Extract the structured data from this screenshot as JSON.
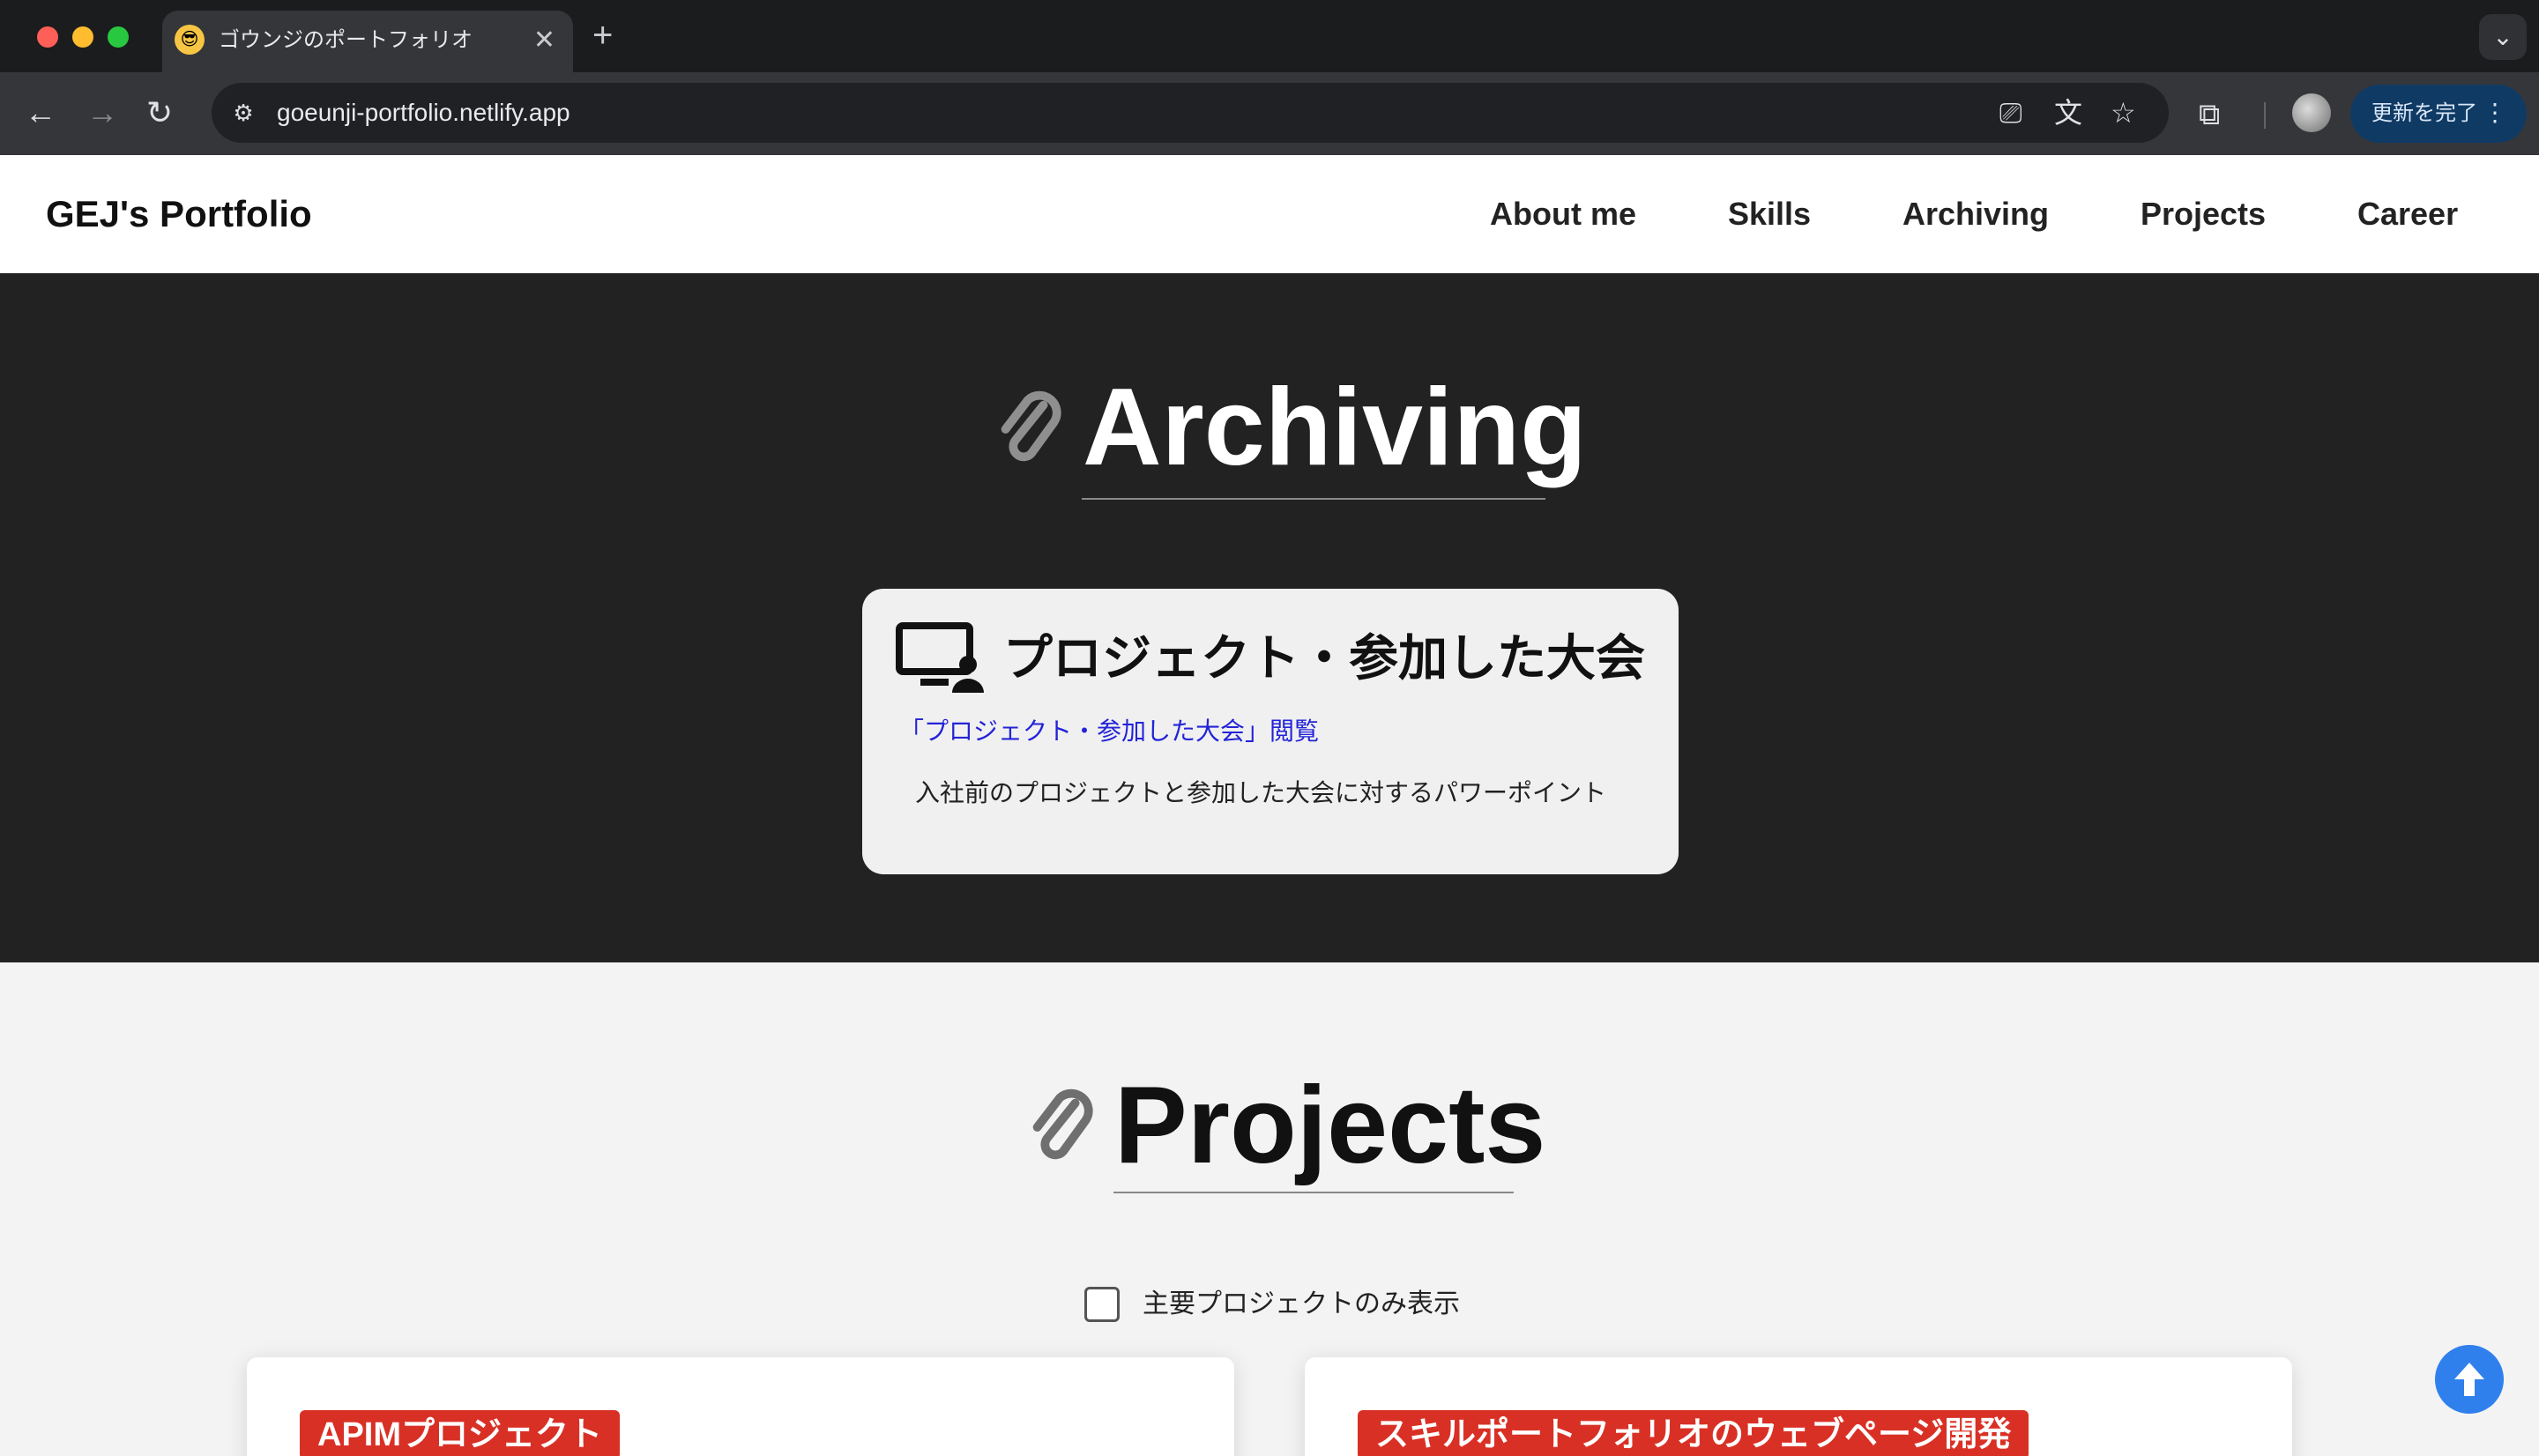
{
  "browser": {
    "tab_title": "ゴウンジのポートフォリオ",
    "tab_favicon": "😎",
    "tab_close": "✕",
    "new_tab": "+",
    "tab_dropdown": "⌄",
    "url": "goeunji-portfolio.netlify.app",
    "back": "←",
    "forward": "→",
    "reload": "↻",
    "site_info": "⚙",
    "install_icon": "⎚",
    "translate_icon": "文",
    "star_icon": "☆",
    "extensions_icon": "⧉",
    "update_label": "更新を完了",
    "menu_icon": "⋮"
  },
  "header": {
    "brand": "GEJ's Portfolio",
    "nav": [
      "About me",
      "Skills",
      "Archiving",
      "Projects",
      "Career"
    ]
  },
  "archiving": {
    "title": "Archiving",
    "card": {
      "heading": "プロジェクト・参加した大会",
      "link": "「プロジェクト・参加した大会」閲覧",
      "description": "入社前のプロジェクトと参加した大会に対するパワーポイント"
    }
  },
  "projects": {
    "title": "Projects",
    "filter_label": "主要プロジェクトのみ表示",
    "filter_checked": false,
    "cards": [
      {
        "badge": "APIMプロジェクト"
      },
      {
        "badge": "スキルポートフォリオのウェブページ開発"
      }
    ]
  },
  "colors": {
    "dark_section": "#222222",
    "badge": "#d93025",
    "link": "#2323d8",
    "scroll_button": "#2f80ed"
  },
  "icons": [
    "paperclip-icon",
    "monitor-user-icon",
    "arrow-up-icon"
  ]
}
